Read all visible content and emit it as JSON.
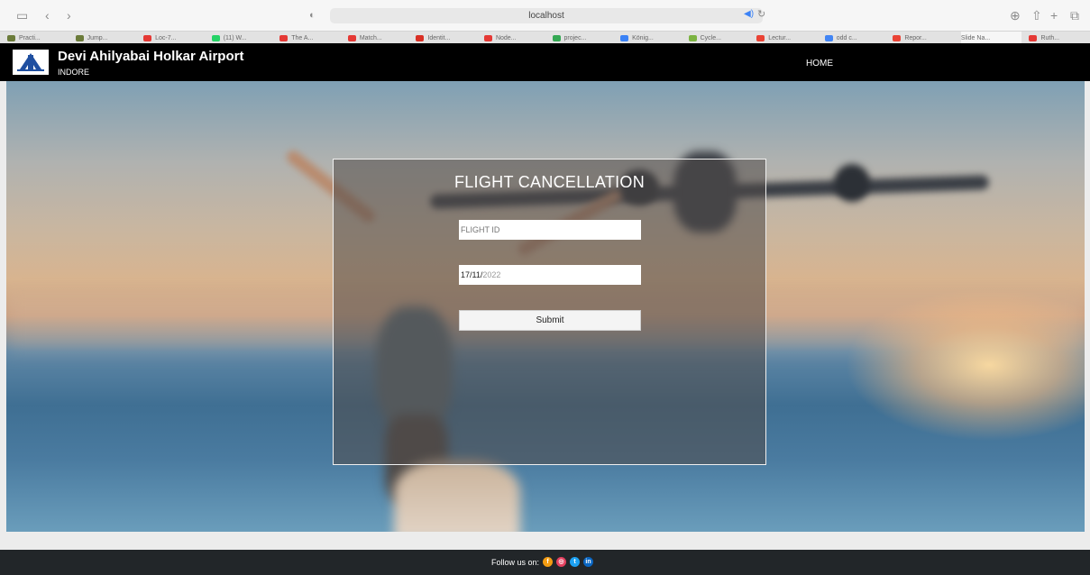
{
  "browser": {
    "url": "localhost",
    "tabs": [
      {
        "label": "Practi...",
        "color": "#6b7b3a"
      },
      {
        "label": "Jump...",
        "color": "#6b7b3a"
      },
      {
        "label": "Loc-7...",
        "color": "#e53935"
      },
      {
        "label": "(11) W...",
        "color": "#25d366"
      },
      {
        "label": "The A...",
        "color": "#e53935"
      },
      {
        "label": "Match...",
        "color": "#e53935"
      },
      {
        "label": "Identit...",
        "color": "#d93025"
      },
      {
        "label": "Node...",
        "color": "#e53935"
      },
      {
        "label": "projec...",
        "color": "#34a853"
      },
      {
        "label": "König...",
        "color": "#3b82f6"
      },
      {
        "label": "Cycle...",
        "color": "#7cb342"
      },
      {
        "label": "Lectur...",
        "color": "#ea4335"
      },
      {
        "label": "odd c...",
        "color": "#4285f4"
      },
      {
        "label": "Repor...",
        "color": "#ea4335"
      },
      {
        "label": "Slide Na...",
        "color": ""
      },
      {
        "label": "Ruth...",
        "color": "#e53935"
      }
    ]
  },
  "header": {
    "title": "Devi Ahilyabai Holkar Airport",
    "subtitle": "INDORE",
    "nav_home": "HOME"
  },
  "form": {
    "title": "FLIGHT CANCELLATION",
    "flight_id_placeholder": "FLIGHT ID",
    "date_day": "17",
    "date_month": "11",
    "date_year": "2022",
    "date_sep": "/",
    "submit_label": "Submit"
  },
  "footer": {
    "follow_text": "Follow us on:",
    "socials": [
      {
        "icon": "facebook-icon",
        "glyph": "f",
        "color": "#f39c12"
      },
      {
        "icon": "instagram-icon",
        "glyph": "◎",
        "color": "#e4405f"
      },
      {
        "icon": "twitter-icon",
        "glyph": "t",
        "color": "#1da1f2"
      },
      {
        "icon": "linkedin-icon",
        "glyph": "in",
        "color": "#0a66c2"
      }
    ]
  }
}
